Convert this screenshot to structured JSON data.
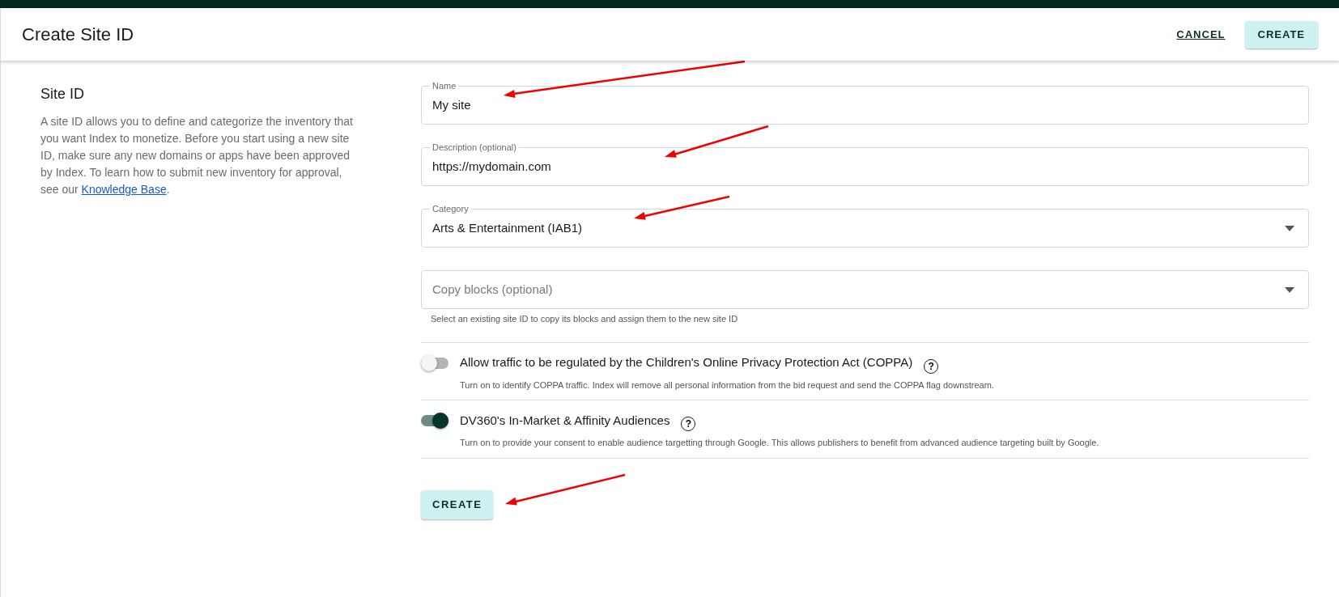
{
  "header": {
    "title": "Create Site ID",
    "cancel": "CANCEL",
    "create": "CREATE"
  },
  "intro": {
    "title": "Site ID",
    "text": "A site ID allows you to define and categorize the inventory that you want Index to monetize. Before you start using a new site ID, make sure any new domains or apps have been approved by Index. To learn how to submit new inventory for approval, see our ",
    "link": "Knowledge Base",
    "after": "."
  },
  "fields": [
    {
      "kind": "text",
      "label": "Name",
      "value": "My site",
      "annotated": true
    },
    {
      "kind": "text",
      "label": "Description (optional)",
      "value": "https://mydomain.com",
      "annotated": true
    },
    {
      "kind": "select",
      "label": "Category",
      "value": "Arts & Entertainment (IAB1)",
      "annotated": true
    },
    {
      "kind": "select",
      "placeholder": "Copy blocks (optional)",
      "helper": "Select an existing site ID to copy its blocks and assign them to the new site ID"
    }
  ],
  "toggles": [
    {
      "label": "Allow traffic to be regulated by the Children's Online Privacy Protection Act (COPPA)",
      "on": false,
      "help_icon": "?",
      "help": "Turn on to identify COPPA traffic. Index will remove all personal information from the bid request and send the COPPA flag downstream."
    },
    {
      "label": "DV360's In-Market & Affinity Audiences",
      "on": true,
      "help_icon": "?",
      "help": "Turn on to provide your consent to enable audience targetting through Google. This allows publishers to benefit from advanced audience targeting built by Google."
    }
  ],
  "submit": {
    "label": "CREATE",
    "annotated": true
  }
}
